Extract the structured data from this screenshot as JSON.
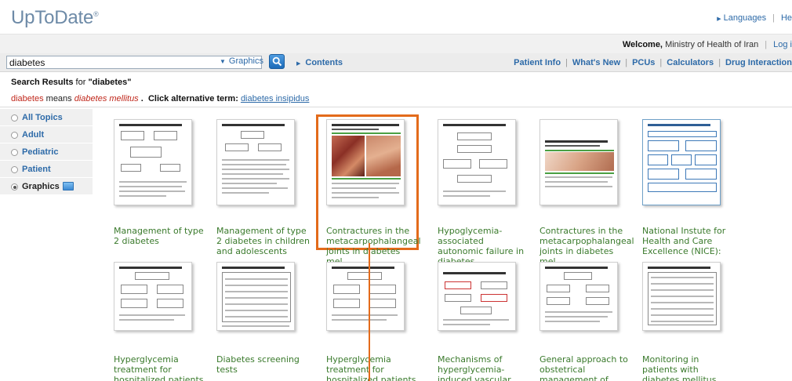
{
  "header": {
    "logo": "UpToDate",
    "logo_mark": "®",
    "links": [
      "Languages",
      "He"
    ]
  },
  "welcome": {
    "label": "Welcome,",
    "org": "Ministry of Health of Iran",
    "login": "Log i"
  },
  "search": {
    "value": "diabetes",
    "scope": "Graphics",
    "contents": "Contents"
  },
  "nav": [
    "Patient Info",
    "What's New",
    "PCUs",
    "Calculators",
    "Drug Interaction"
  ],
  "results": {
    "prefix": "Search Results",
    "middle": "for",
    "query": "\"diabetes\""
  },
  "alt": {
    "term": "diabetes",
    "means": "means",
    "meaning": "diabetes mellitus",
    "period": ".",
    "click": "Click alternative term:",
    "alt_term": "diabetes insipidus"
  },
  "sidebar": {
    "items": [
      {
        "label": "All Topics"
      },
      {
        "label": "Adult"
      },
      {
        "label": "Pediatric"
      },
      {
        "label": "Patient"
      },
      {
        "label": "Graphics"
      }
    ]
  },
  "graphics": [
    {
      "label": "Management of type 2 diabetes"
    },
    {
      "label": "Management of type 2 diabetes in children and adolescents"
    },
    {
      "label": "Contractures in the metacarpophalangeal joints in diabetes mel..."
    },
    {
      "label": "Hypoglycemia-associated autonomic failure in diabetes"
    },
    {
      "label": "Contractures in the metacarpophalangeal joints in diabetes mel..."
    },
    {
      "label": "National Instute for Health and Care Excellence (NICE):"
    },
    {
      "label": "Hyperglycemia treatment for hospitalized patients eating a nor..."
    },
    {
      "label": "Diabetes screening tests"
    },
    {
      "label": "Hyperglycemia treatment for hospitalized patients receiving no..."
    },
    {
      "label": "Mechanisms of hyperglycemia-induced vascular complications"
    },
    {
      "label": "General approach to obstetrical management of uncomplicated GDM"
    },
    {
      "label": "Monitoring in patients with diabetes mellitus"
    }
  ],
  "colors": {
    "brand_blue": "#2d6aa8",
    "highlight": "#e36b1b",
    "caption_green": "#3a7a2c",
    "alert_red": "#c0281c"
  }
}
